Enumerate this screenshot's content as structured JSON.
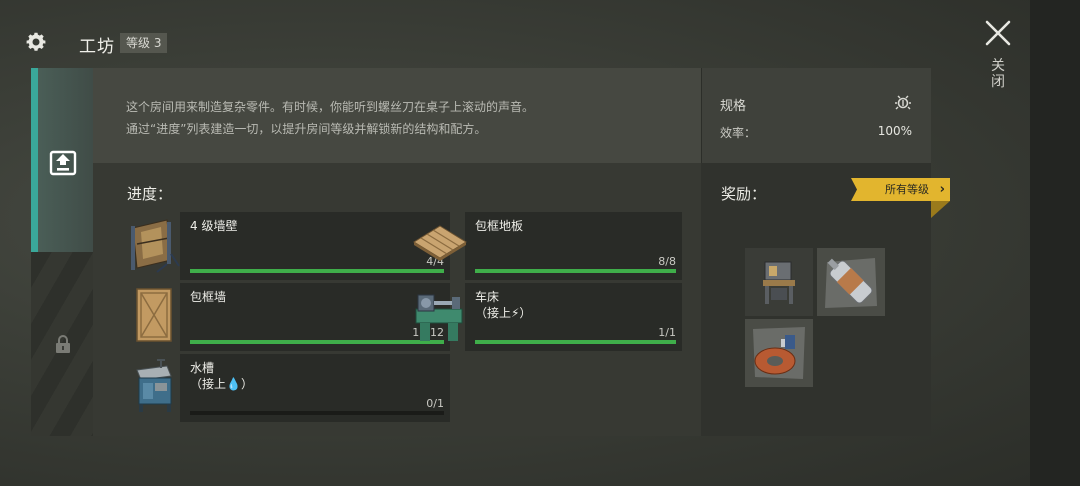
{
  "header": {
    "title": "工坊",
    "level_badge": "等级 3",
    "close_label": "关闭"
  },
  "tabs": [
    {
      "icon": "upgrade-icon",
      "state": "active"
    },
    {
      "icon": "lock-icon",
      "state": "locked"
    }
  ],
  "description": {
    "line1": "这个房间用来制造复杂零件。有时候，你能听到螺丝刀在桌子上滚动的声音。",
    "line2": "通过“进度”列表建造一切，以提升房间等级并解锁新的结构和配方。"
  },
  "specs": {
    "title": "规格",
    "efficiency_label": "效率：",
    "efficiency_value": "100%"
  },
  "progress": {
    "title": "进度：",
    "items": [
      {
        "name": "4 级墙壁",
        "sub": "",
        "count": "4/4",
        "fraction": 1.0,
        "icon": "wall-icon"
      },
      {
        "name": "包框地板",
        "sub": "",
        "count": "8/8",
        "fraction": 1.0,
        "icon": "floor-icon"
      },
      {
        "name": "包框墙",
        "sub": "",
        "count": "12/12",
        "fraction": 1.0,
        "icon": "framed-wall-icon"
      },
      {
        "name": "车床",
        "sub": "（接上⚡）",
        "count": "1/1",
        "fraction": 1.0,
        "icon": "lathe-icon"
      },
      {
        "name": "水槽",
        "sub": "（接上💧）",
        "count": "0/1",
        "fraction": 0.0,
        "icon": "sink-icon"
      }
    ]
  },
  "rewards": {
    "title": "奖励：",
    "all_levels_label": "所有等级",
    "items": [
      {
        "icon": "workbench-icon"
      },
      {
        "icon": "motor-part-icon"
      },
      {
        "icon": "copper-coil-icon"
      }
    ]
  },
  "colors": {
    "accent_teal": "#3aa89a",
    "progress_green": "#3fae4a",
    "badge_yellow": "#e2b52e"
  }
}
